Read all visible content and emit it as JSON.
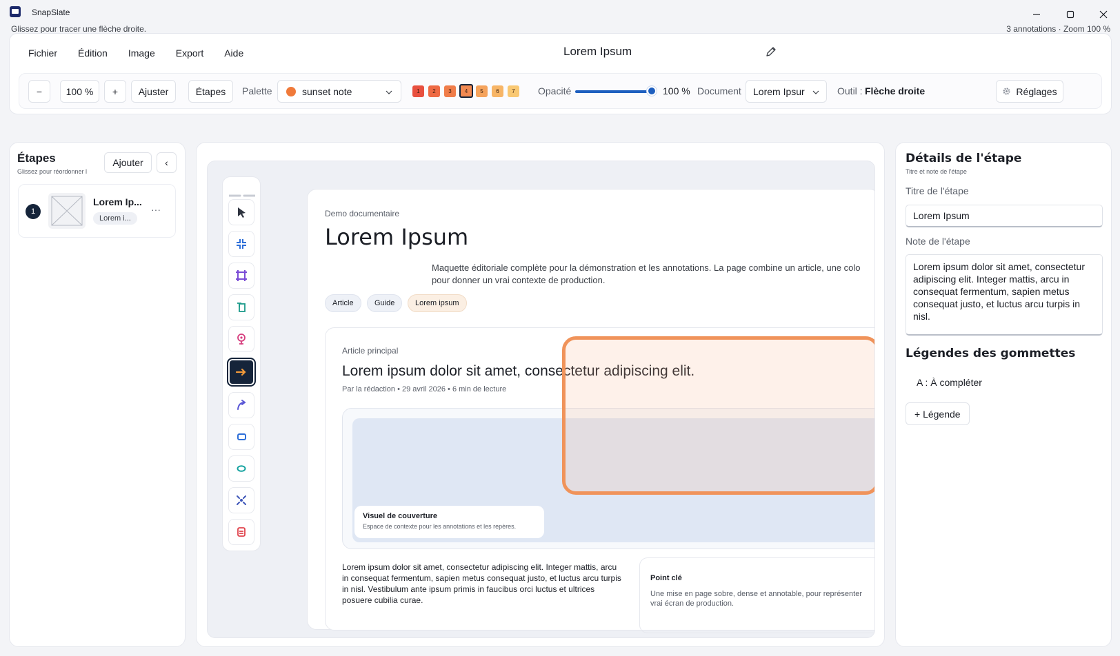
{
  "window": {
    "app_title": "SnapSlate",
    "status_hint": "Glissez pour tracer une flèche droite.",
    "status_right": "3 annotations · Zoom 100 %"
  },
  "menu": [
    "Fichier",
    "Édition",
    "Image",
    "Export",
    "Aide"
  ],
  "document_title": "Lorem Ipsum",
  "toolbar": {
    "zoom_out": "−",
    "zoom_value": "100 %",
    "zoom_in": "+",
    "fit": "Ajuster",
    "steps": "Étapes",
    "palette_label": "Palette",
    "palette_value": "sunset note",
    "palette_color": "#f07a3a",
    "swatches": [
      {
        "label": "1",
        "color": "#e8503f"
      },
      {
        "label": "2",
        "color": "#ee6a44"
      },
      {
        "label": "3",
        "color": "#f07d4a"
      },
      {
        "label": "4",
        "color": "#f28a52"
      },
      {
        "label": "5",
        "color": "#f5a35c"
      },
      {
        "label": "6",
        "color": "#f7b566"
      },
      {
        "label": "7",
        "color": "#f9c872"
      }
    ],
    "opacity_label": "Opacité",
    "opacity_value": "100 %",
    "opacity_fraction": 1.0,
    "document_label": "Document",
    "document_value": "Lorem Ipsur",
    "tool_label": "Outil :",
    "tool_value": "Flèche droite",
    "settings": "Réglages"
  },
  "left_panel": {
    "title": "Étapes",
    "subtitle": "Glissez pour réordonner l",
    "add_button": "Ajouter",
    "collapse": "‹",
    "steps": [
      {
        "number": "1",
        "title": "Lorem Ip...",
        "tag": "Lorem i...",
        "more": "···"
      }
    ]
  },
  "tools": [
    "select-icon",
    "crop-icon",
    "frame-icon",
    "text-icon",
    "pin-icon",
    "arrow-straight-icon",
    "arrow-curved-icon",
    "rectangle-icon",
    "ellipse-icon",
    "blur-icon",
    "redact-icon"
  ],
  "page": {
    "kicker": "Demo documentaire",
    "title": "Lorem Ipsum",
    "intro_line1": "Maquette éditoriale complète pour la démonstration et les annotations. La page combine un article, une colo",
    "intro_line2": "pour donner un vrai contexte de production.",
    "chips": [
      "Article",
      "Guide",
      "Lorem ipsum"
    ],
    "article": {
      "kicker": "Article principal",
      "title": "Lorem ipsum dolor sit amet, consectetur adipiscing elit.",
      "meta": "Par la rédaction • 29 avril 2026 • 6 min de lecture",
      "caption_title": "Visuel de couverture",
      "caption_desc": "Espace de contexte pour les annotations et les repères.",
      "body": "Lorem ipsum dolor sit amet, consectetur adipiscing elit. Integer mattis, arcu in consequat fermentum, sapien metus consequat justo, et luctus arcu turpis in nisl. Vestibulum ante ipsum primis in faucibus orci luctus et ultrices posuere cubilia curae.",
      "keypoint_title": "Point clé",
      "keypoint_line1": "Une mise en page sobre, dense et annotable, pour représenter",
      "keypoint_line2": "vrai écran de production."
    }
  },
  "right_panel": {
    "title": "Détails de l'étape",
    "subtitle": "Titre et note de l'étape",
    "title_label": "Titre de l'étape",
    "title_value": "Lorem Ipsum",
    "note_label": "Note de l'étape",
    "note_value": "Lorem ipsum dolor sit amet, consectetur adipiscing elit. Integer mattis, arcu in consequat fermentum, sapien metus consequat justo, et luctus arcu turpis in nisl.",
    "legend_title": "Légendes des gommettes",
    "legend_item": "A : À compléter",
    "add_legend": "+ Légende"
  },
  "colors": {
    "accent": "#1e5fbf",
    "annotation": "#f0935a",
    "active_tool": "#15243a"
  }
}
